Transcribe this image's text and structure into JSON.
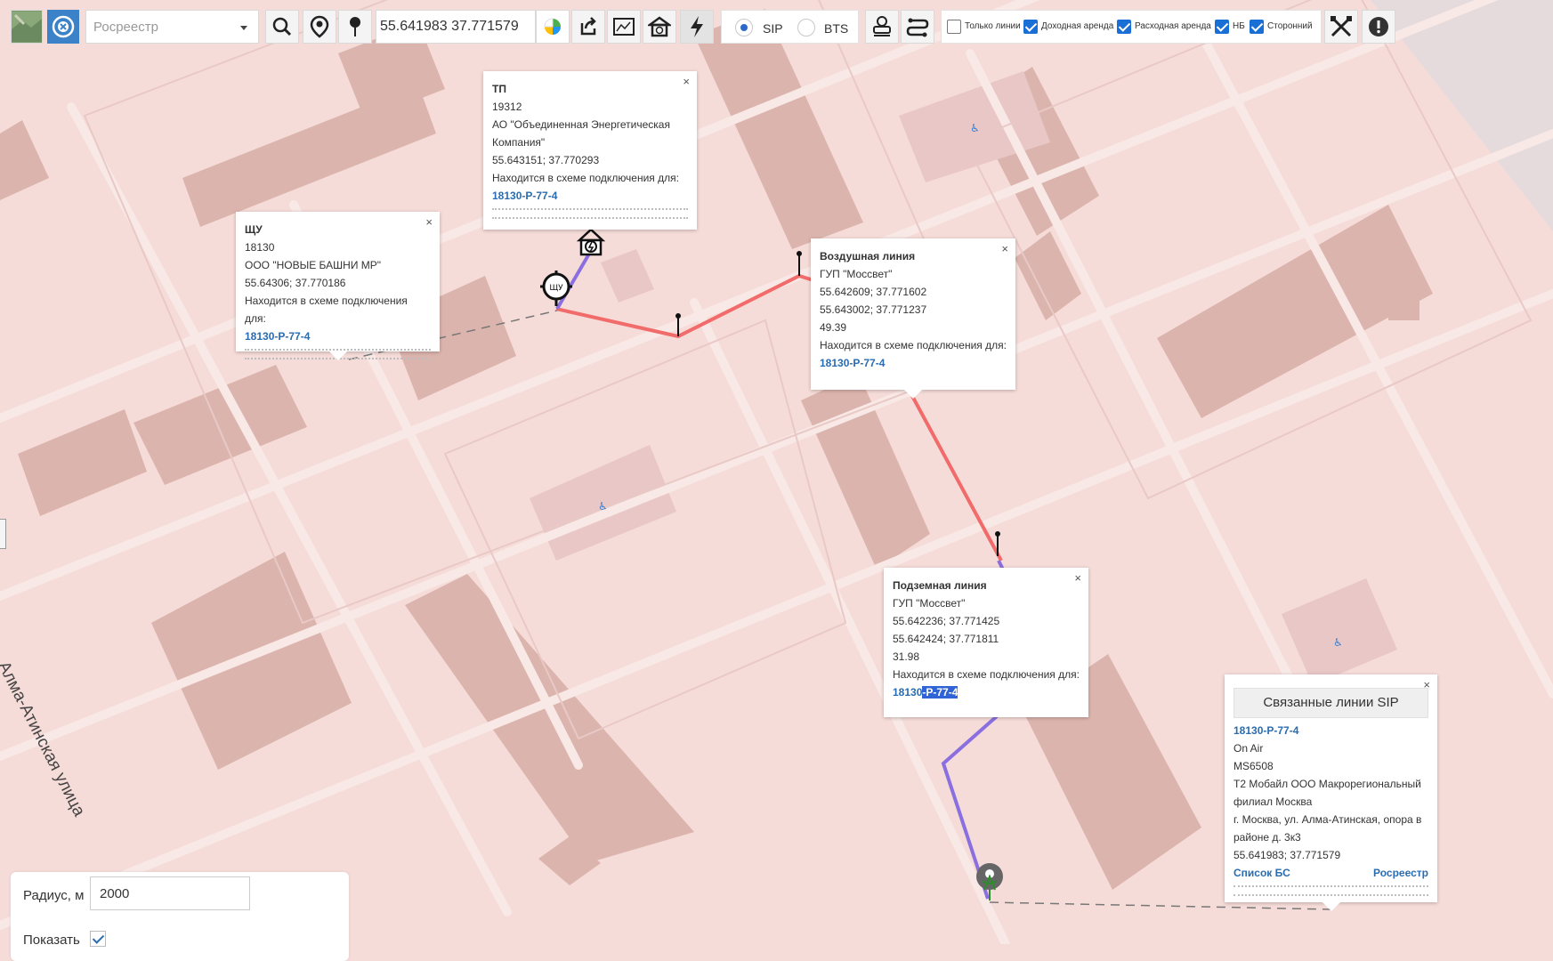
{
  "toolbar": {
    "layer_select": "Росреестр",
    "coordinates": "55.641983 37.771579",
    "radio_sip": "SIP",
    "radio_bts": "BTS",
    "filters": [
      {
        "label": "Только линии",
        "checked": false
      },
      {
        "label": "Доходная аренда",
        "checked": true
      },
      {
        "label": "Расходная аренда",
        "checked": true
      },
      {
        "label": "НБ",
        "checked": true
      },
      {
        "label": "Сторонний",
        "checked": true
      }
    ]
  },
  "map": {
    "street_label": "Алма-Атинская улица"
  },
  "popups": {
    "tp": {
      "close": "×",
      "title": "ТП",
      "id": "19312",
      "org_line1": "АО \"Объединенная Энергетическая",
      "org_line2": "Компания\"",
      "coords": "55.643151; 37.770293",
      "scheme_label": "Находится в схеме подключения для:",
      "scheme_link": "18130-Р-77-4"
    },
    "shu": {
      "close": "×",
      "title": "ЩУ",
      "id": "18130",
      "org": "ООО \"НОВЫЕ БАШНИ МР\"",
      "coords": "55.64306; 37.770186",
      "scheme_label": "Находится в схеме подключения для:",
      "scheme_link": "18130-Р-77-4"
    },
    "air": {
      "close": "×",
      "title": "Воздушная линия",
      "org": "ГУП \"Моссвет\"",
      "coords1": "55.642609; 37.771602",
      "coords2": "55.643002; 37.771237",
      "length": "49.39",
      "scheme_label": "Находится в схеме подключения для:",
      "scheme_link": "18130-Р-77-4"
    },
    "underground": {
      "close": "×",
      "title": "Подземная линия",
      "org": "ГУП \"Моссвет\"",
      "coords1": "55.642236; 37.771425",
      "coords2": "55.642424; 37.771811",
      "length": "31.98",
      "scheme_label": "Находится в схеме подключения для:",
      "scheme_link_a": "18130",
      "scheme_link_b": "-Р-77-4"
    },
    "sip": {
      "close": "×",
      "header": "Связанные линии SIP",
      "link": "18130-Р-77-4",
      "status": "On Air",
      "code": "MS6508",
      "org_line1": "Т2 Мобайл ООО Макрорегиональный",
      "org_line2": "филиал Москва",
      "addr_line1": "г. Москва, ул. Алма-Атинская, опора в",
      "addr_line2": "районе д. 3к3",
      "coords": "55.641983; 37.771579",
      "bs_list": "Список БС",
      "rosreestr": "Росреестр"
    }
  },
  "radius_panel": {
    "label": "Радиус, м",
    "value": "2000",
    "show_label": "Показать"
  },
  "colors": {
    "air_line": "#f26b6b",
    "underground_line": "#8a6fe0",
    "link": "#2a6cb0"
  }
}
